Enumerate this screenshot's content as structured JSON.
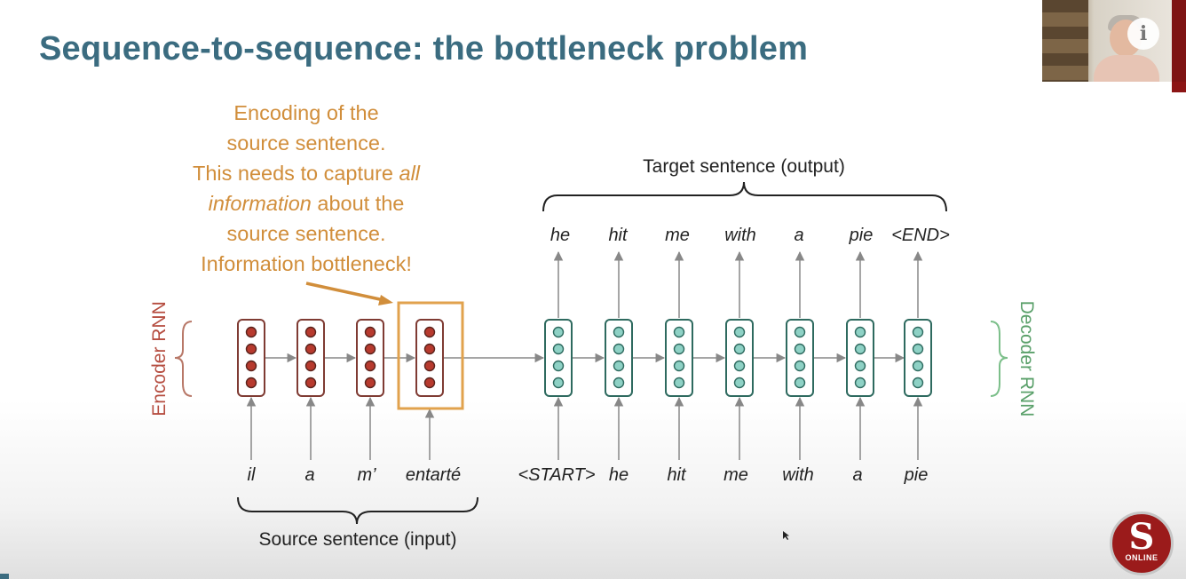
{
  "title": "Sequence-to-sequence: the bottleneck problem",
  "annotation": {
    "line1": "Encoding of the",
    "line2": "source sentence.",
    "line3": "This needs to capture ",
    "line3_italic": "all",
    "line4_italic": "information",
    "line4_rest": " about the",
    "line5": "source sentence.",
    "line6": "Information bottleneck!"
  },
  "target_label": "Target sentence (output)",
  "source_label": "Source sentence (input)",
  "encoder_label": "Encoder RNN",
  "decoder_label": "Decoder RNN",
  "encoder_inputs": [
    "il",
    "a",
    "m’",
    "entarté"
  ],
  "decoder_inputs": [
    "<START>",
    "he",
    "hit",
    "me",
    "with",
    "a",
    "pie"
  ],
  "decoder_outputs": [
    "he",
    "hit",
    "me",
    "with",
    "a",
    "pie",
    "<END>"
  ],
  "colors": {
    "title": "#3b6c80",
    "annotation": "#d18e3b",
    "encoder": "#7f3b33",
    "encoder_dot": "#b73a2e",
    "decoder": "#2e6a5f",
    "decoder_dot": "#8ed1c5",
    "decoder_label": "#5aa06a",
    "highlight": "#e1a24d",
    "arrow": "#888888"
  },
  "logo": {
    "letter": "S",
    "text": "ONLINE"
  },
  "info_icon": "info-icon"
}
